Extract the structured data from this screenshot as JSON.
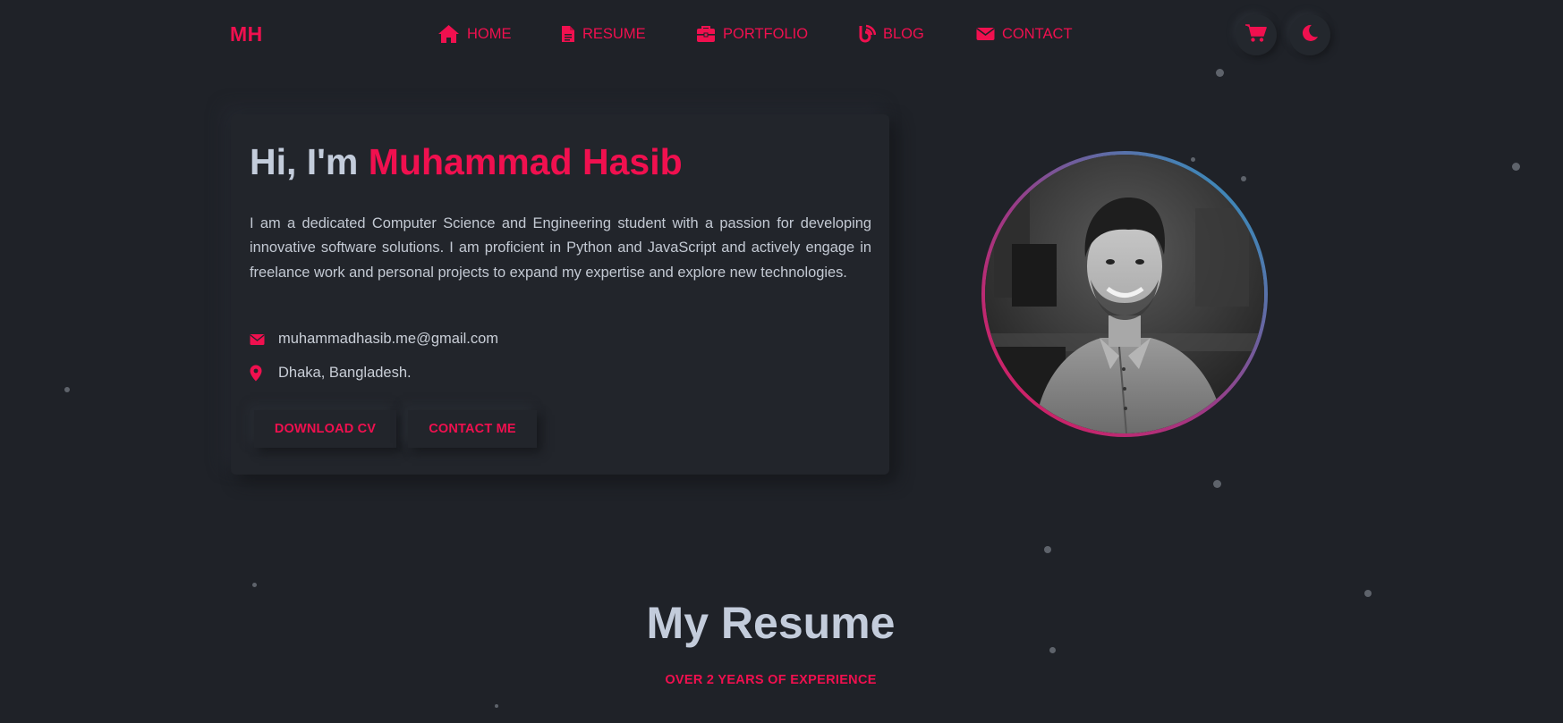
{
  "logo": "MH",
  "nav": {
    "items": [
      {
        "label": "HOME",
        "icon": "home-icon"
      },
      {
        "label": "RESUME",
        "icon": "file-icon"
      },
      {
        "label": "PORTFOLIO",
        "icon": "briefcase-icon"
      },
      {
        "label": "BLOG",
        "icon": "blog-icon"
      },
      {
        "label": "CONTACT",
        "icon": "envelope-icon"
      }
    ],
    "cart_icon": "cart-icon",
    "theme_icon": "moon-icon"
  },
  "hero": {
    "greeting": "Hi, I'm",
    "name": "Muhammad Hasib",
    "bio": "I am a dedicated Computer Science and Engineering student with a passion for developing innovative software solutions. I am proficient in Python and JavaScript and actively engage in freelance work and personal projects to expand my expertise and explore new technologies.",
    "email": "muhammadhasib.me@gmail.com",
    "location": "Dhaka, Bangladesh.",
    "download_cv_label": "DOWNLOAD CV",
    "contact_me_label": "CONTACT ME"
  },
  "resume": {
    "title": "My Resume",
    "subtitle": "OVER 2 YEARS OF EXPERIENCE"
  },
  "colors": {
    "accent": "#f0104f",
    "background": "#1f2228",
    "heading": "#c3ccdb",
    "ring_start": "#e3175a",
    "ring_end": "#1fa2c9"
  }
}
